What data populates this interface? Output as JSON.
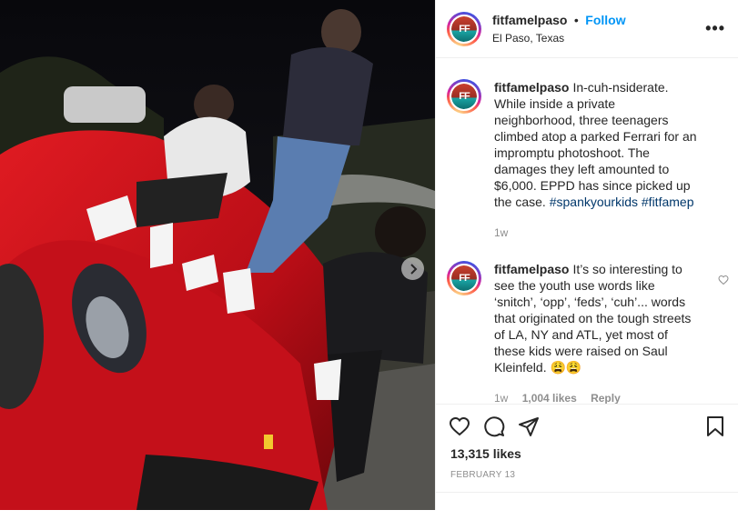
{
  "post": {
    "username": "fitfamelpaso",
    "dot": "•",
    "follow_label": "Follow",
    "location": "El Paso, Texas",
    "more_label": "•••",
    "avatar_text": "FF"
  },
  "comments": [
    {
      "username": "fitfamelpaso",
      "text": "In-cuh-nsiderate. While inside a private neighborhood, three teenagers climbed atop a parked Ferrari for an impromptu photoshoot. The damages they left amounted to $6,000. EPPD has since picked up the case.",
      "hashtags": [
        "#spankyourkids",
        "#fitfamep"
      ],
      "time": "1w"
    },
    {
      "username": "fitfamelpaso",
      "text": "It’s so interesting to see the youth use words like ‘snitch’, ‘opp’, ‘feds’, ‘cuh’... words that originated on the tough streets of LA, NY and ATL, yet most of these kids were raised on Saul Kleinfeld. 😩😩",
      "time": "1w",
      "likes": "1,004 likes",
      "reply_label": "Reply"
    }
  ],
  "actions": {
    "likes": "13,315 likes",
    "date": "FEBRUARY 13",
    "icons": [
      "heart-icon",
      "comment-icon",
      "share-icon",
      "bookmark-icon"
    ]
  },
  "colors": {
    "accent": "#0095f6",
    "hashtag": "#00376b",
    "muted": "#8e8e8e",
    "car_red": "#d4121c"
  }
}
